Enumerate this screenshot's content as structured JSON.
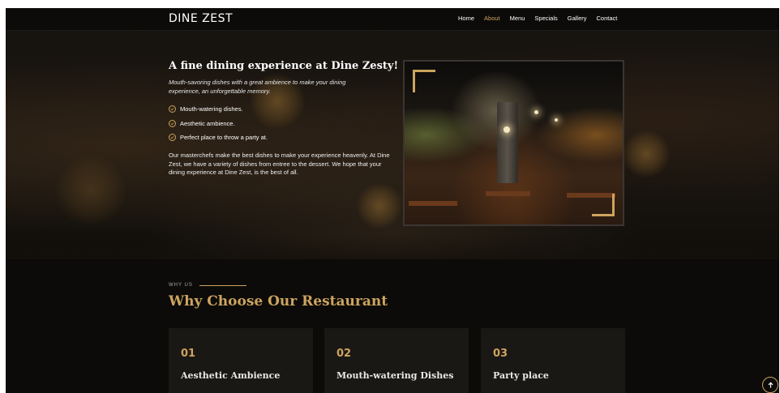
{
  "navbar": {
    "brand": "DINE ZEST",
    "links": [
      {
        "label": "Home"
      },
      {
        "label": "About",
        "active": true
      },
      {
        "label": "Menu"
      },
      {
        "label": "Specials"
      },
      {
        "label": "Gallery"
      },
      {
        "label": "Contact"
      }
    ]
  },
  "hero": {
    "title": "A fine dining experience at Dine Zesty!",
    "subtitle": "Mouth-savoring dishes with a great ambience to make your dining experience, an unforgettable memory.",
    "features": [
      "Mouth-watering dishes.",
      "Aesthetic ambience.",
      "Perfect place to throw a party at."
    ],
    "paragraph": "Our masterchefs make the best dishes to make your experience heavenly. At Dine Zest, we have a variety of dishes from entree to the dessert. We hope that your dining experience at Dine Zest, is the best of all."
  },
  "why": {
    "label": "WHY US",
    "title": "Why Choose Our Restaurant",
    "cards": [
      {
        "number": "01",
        "title": "Aesthetic Ambience"
      },
      {
        "number": "02",
        "title": "Mouth-watering Dishes"
      },
      {
        "number": "03",
        "title": "Party place"
      }
    ]
  },
  "colors": {
    "accent": "#cda45e",
    "background": "#0c0b09",
    "card": "#1a1814"
  },
  "icons": {
    "feature": "check-circle-icon",
    "back_to_top": "arrow-up-icon"
  }
}
